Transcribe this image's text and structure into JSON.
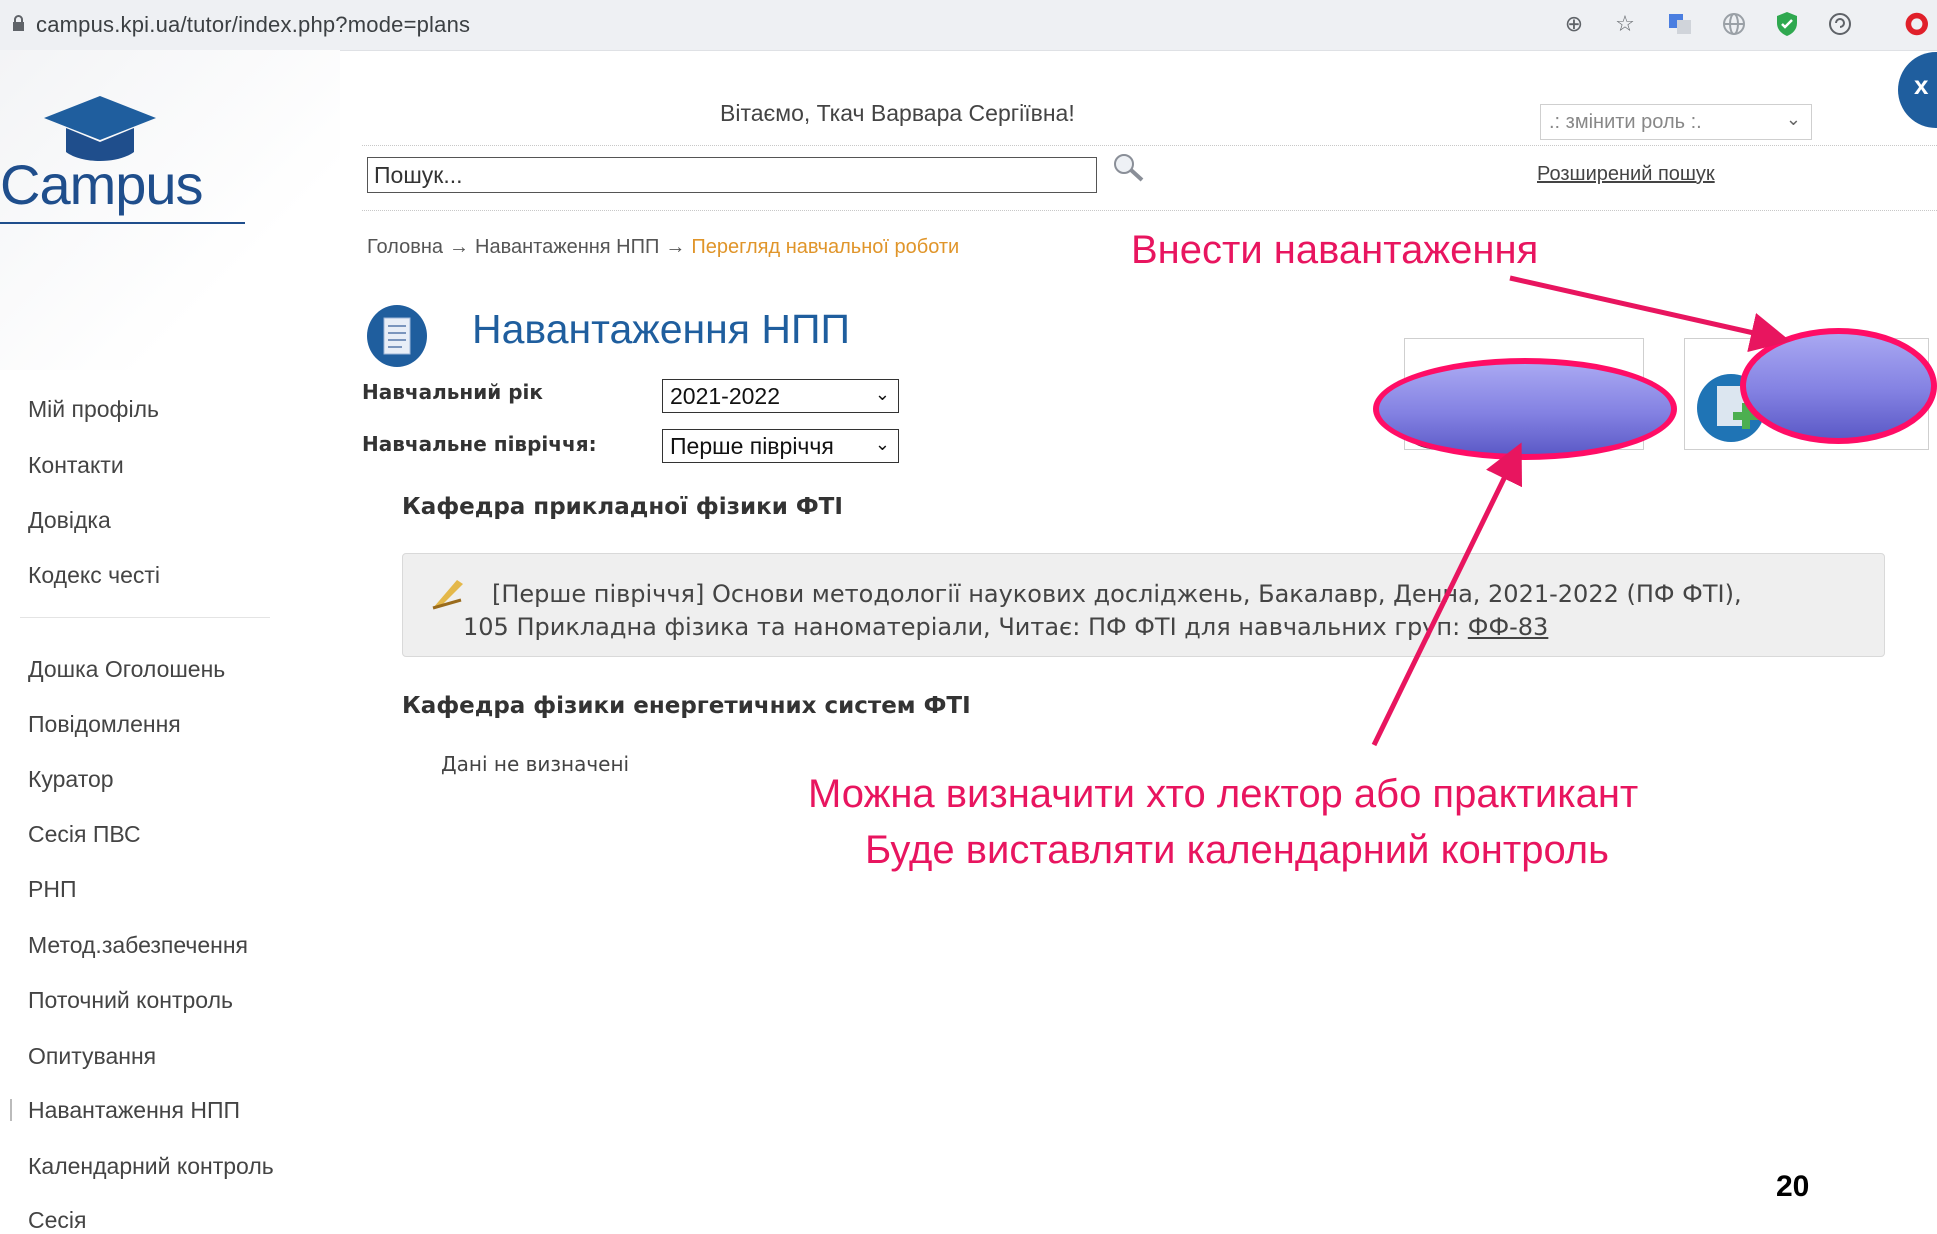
{
  "browser": {
    "url": "campus.kpi.ua/tutor/index.php?mode=plans"
  },
  "header": {
    "logo_text": "Campus",
    "welcome": "Вітаємо, Ткач Варвара Сергіївна!",
    "role_select": ".: змінити роль :.",
    "close_label": "x",
    "search_placeholder": "Пошук...",
    "advanced_search": "Розширений пошук"
  },
  "breadcrumb": {
    "items": [
      "Головна",
      "Навантаження НПП",
      "Перегляд навчальної роботи"
    ],
    "separator": "→"
  },
  "page": {
    "title": "Навантаження НПП",
    "year_label": "Навчальний рік",
    "year_value": "2021-2022",
    "semester_label": "Навчальне півріччя:",
    "semester_value": "Перше півріччя"
  },
  "departments": [
    {
      "name": "Кафедра прикладної фізики ФТІ",
      "course_line1": "[Перше півріччя] Основи методології наукових досліджень, Бакалавр, Денна, 2021-2022 (ПФ ФТІ),",
      "course_line2": "105 Прикладна фізика та наноматеріали, Читає: ПФ ФТІ для навчальних груп: ",
      "group": "ФФ-83"
    },
    {
      "name": "Кафедра фізики енергетичних систем ФТІ",
      "empty": "Дані не визначені"
    }
  ],
  "sidebar": {
    "items": [
      "Мій профіль",
      "Контакти",
      "Довідка",
      "Кодекс честі",
      "Дошка Оголошень",
      "Повідомлення",
      "Куратор",
      "Сесія ПВС",
      "РНП",
      "Метод.забезпечення",
      "Поточний контроль",
      "Опитування",
      "Навантаження НПП",
      "Календарний контроль",
      "Сесія"
    ]
  },
  "annotations": {
    "add_load": "Внести навантаження",
    "note_line1": "Можна визначити хто лектор або практикант",
    "note_line2": "Буде виставляти календарний контроль",
    "accent_color": "#e8155f"
  },
  "slide_number": "20"
}
